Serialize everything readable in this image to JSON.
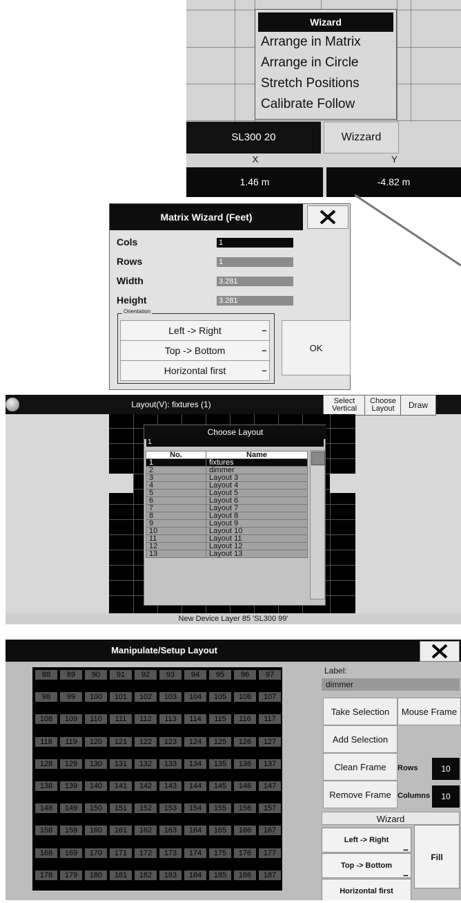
{
  "panel1": {
    "wizard_menu": {
      "header": "Wizard",
      "items": [
        "Arrange in Matrix",
        "Arrange in Circle",
        "Stretch Positions",
        "Calibrate Follow"
      ]
    },
    "device_name": "SL300 20",
    "wizard_button": "Wizzard",
    "x_label": "X",
    "y_label": "Y",
    "x_value": "1.46 m",
    "y_value": "-4.82 m"
  },
  "matrix_wizard": {
    "title": "Matrix Wizard (Feet)",
    "fields": [
      {
        "label": "Cols",
        "value": "1"
      },
      {
        "label": "Rows",
        "value": "1"
      },
      {
        "label": "Width",
        "value": "3.281"
      },
      {
        "label": "Height",
        "value": "3.281"
      }
    ],
    "orientation_legend": "Orientation",
    "orientation_buttons": [
      "Left -> Right",
      "Top -> Bottom",
      "Horizontal first"
    ],
    "ok": "OK"
  },
  "layout_view": {
    "title": "Layout(V): fixtures (1)",
    "buttons": {
      "select_vertical": "Select Vertical",
      "choose_layout": "Choose Layout",
      "draw": "Draw"
    },
    "choose_dialog": {
      "title": "Choose Layout",
      "input": "1",
      "headers": [
        "No.",
        "Name"
      ],
      "rows": [
        {
          "no": "1",
          "name": "fixtures"
        },
        {
          "no": "2",
          "name": "dimmer"
        },
        {
          "no": "3",
          "name": "Layout 3"
        },
        {
          "no": "4",
          "name": "Layout 4"
        },
        {
          "no": "5",
          "name": "Layout 5"
        },
        {
          "no": "6",
          "name": "Layout 6"
        },
        {
          "no": "7",
          "name": "Layout 7"
        },
        {
          "no": "8",
          "name": "Layout 8"
        },
        {
          "no": "9",
          "name": "Layout 9"
        },
        {
          "no": "10",
          "name": "Layout 10"
        },
        {
          "no": "11",
          "name": "Layout 11"
        },
        {
          "no": "12",
          "name": "Layout 12"
        },
        {
          "no": "13",
          "name": "Layout 13"
        }
      ],
      "selected_row": 0
    },
    "status": "New Device Layer 85 'SL300 99'"
  },
  "manipulate": {
    "title": "Manipulate/Setup Layout",
    "grid_start": 88,
    "grid_cols": 10,
    "grid_rows": 10,
    "label_caption": "Label:",
    "label_value": "dimmer",
    "take_selection": "Take Selection",
    "mouse_frame": "Mouse Frame",
    "add_selection": "Add Selection",
    "clean_frame": "Clean Frame",
    "remove_frame": "Remove Frame",
    "rows_label": "Rows",
    "rows_value": "10",
    "columns_label": "Columns",
    "columns_value": "10",
    "wizard_label": "Wizard",
    "left_right": "Left   -> Right",
    "top_bottom": "Top     -> Bottom",
    "horizontal_first": "Horizontal first",
    "fill": "Fill"
  }
}
